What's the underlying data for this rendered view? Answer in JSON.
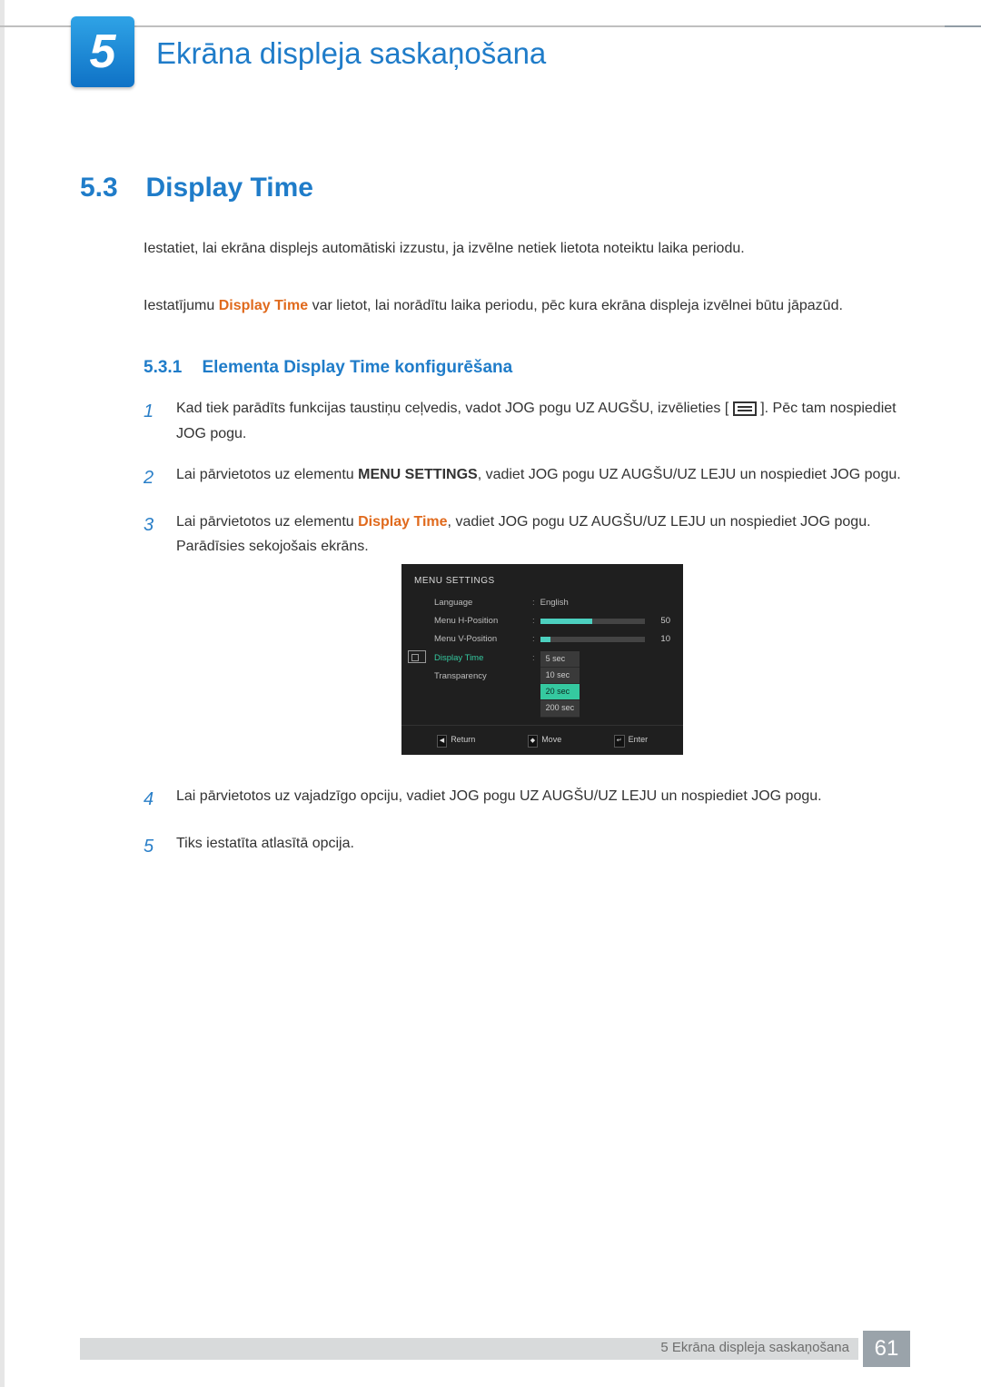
{
  "chapter": {
    "number": "5",
    "title": "Ekrāna displeja saskaņošana"
  },
  "section": {
    "number": "5.3",
    "title": "Display Time"
  },
  "intro1": "Iestatiet, lai ekrāna displejs automātiski izzustu, ja izvēlne netiek lietota noteiktu laika periodu.",
  "intro2a": "Iestatījumu ",
  "intro2b": "Display Time",
  "intro2c": " var lietot, lai norādītu laika periodu, pēc kura ekrāna displeja izvēlnei būtu jāpazūd.",
  "subsection": {
    "number": "5.3.1",
    "title": "Elementa Display Time konfigurēšana"
  },
  "steps": [
    {
      "n": "1",
      "pre": "Kad tiek parādīts funkcijas taustiņu ceļvedis, vadot JOG pogu UZ AUGŠU, izvēlieties [",
      "post": "]. Pēc tam nospiediet JOG pogu."
    },
    {
      "n": "2",
      "a": "Lai pārvietotos uz elementu ",
      "bold": "MENU SETTINGS",
      "b": ", vadiet JOG pogu UZ AUGŠU/UZ LEJU un nospiediet JOG pogu."
    },
    {
      "n": "3",
      "a": "Lai pārvietotos uz elementu ",
      "orange": "Display Time",
      "b": ", vadiet JOG pogu UZ AUGŠU/UZ LEJU un nospiediet JOG pogu. Parādīsies sekojošais ekrāns."
    },
    {
      "n": "4",
      "text": "Lai pārvietotos uz vajadzīgo opciju, vadiet JOG pogu UZ AUGŠU/UZ LEJU un nospiediet JOG pogu."
    },
    {
      "n": "5",
      "text": "Tiks iestatīta atlasītā opcija."
    }
  ],
  "osd": {
    "title": "MENU SETTINGS",
    "items": [
      "Language",
      "Menu H-Position",
      "Menu V-Position",
      "Display Time",
      "Transparency"
    ],
    "language_value": "English",
    "hpos": "50",
    "vpos": "10",
    "options": [
      "5 sec",
      "10 sec",
      "20 sec",
      "200 sec"
    ],
    "highlight_index": 2,
    "footer": {
      "return": "Return",
      "move": "Move",
      "enter": "Enter"
    }
  },
  "footer": {
    "label": "5 Ekrāna displeja saskaņošana",
    "page": "61"
  }
}
